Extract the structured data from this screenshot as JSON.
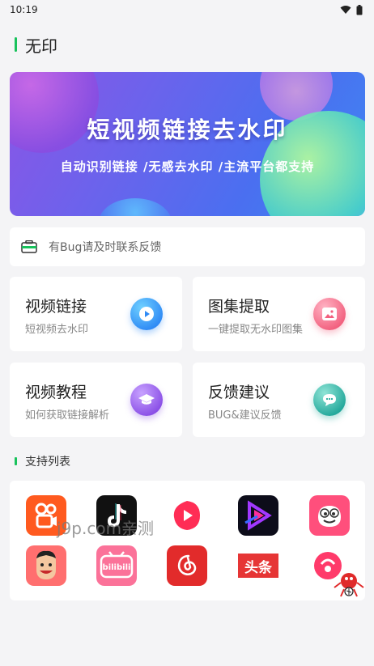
{
  "status_bar": {
    "time": "10:19",
    "icons": [
      "wifi-icon",
      "battery-icon"
    ]
  },
  "app": {
    "title": "无印"
  },
  "banner": {
    "title": "短视频链接去水印",
    "subtitle": "自动识别链接 /无感去水印 /主流平台都支持"
  },
  "notice": {
    "text": "有Bug请及时联系反馈",
    "icon": "toolbox-icon"
  },
  "cards": [
    {
      "title": "视频链接",
      "subtitle": "短视频去水印",
      "icon": "play-icon",
      "color": "#2f8af5"
    },
    {
      "title": "图集提取",
      "subtitle": "一键提取无水印图集",
      "icon": "image-icon",
      "color": "#f2607e"
    },
    {
      "title": "视频教程",
      "subtitle": "如何获取链接解析",
      "icon": "graduation-cap-icon",
      "color": "#8a4fe6"
    },
    {
      "title": "反馈建议",
      "subtitle": "BUG&建议反馈",
      "icon": "chat-bubble-icon",
      "color": "#23a89b"
    }
  ],
  "section": {
    "title": "支持列表"
  },
  "platforms": [
    {
      "name": "kuaishou-icon",
      "color": "#ff5a1f"
    },
    {
      "name": "douyin-icon",
      "color": "#111111"
    },
    {
      "name": "weishi-icon",
      "color": "#ff2d55"
    },
    {
      "name": "video-app-icon",
      "color": "#6a2cff"
    },
    {
      "name": "pipi-icon",
      "color": "#ff4f7c"
    },
    {
      "name": "face-app-icon",
      "color": "#ff6f6f"
    },
    {
      "name": "bilibili-icon",
      "color": "#fb7299"
    },
    {
      "name": "netease-music-icon",
      "color": "#e22b2b"
    },
    {
      "name": "toutiao-icon",
      "color": "#e63535"
    },
    {
      "name": "round-app-icon",
      "color": "#ff3a6a"
    }
  ],
  "platform_labels": {
    "toutiao": "头条",
    "bilibili": "bilibili"
  },
  "watermark": {
    "text": "j9p.com亲测"
  }
}
